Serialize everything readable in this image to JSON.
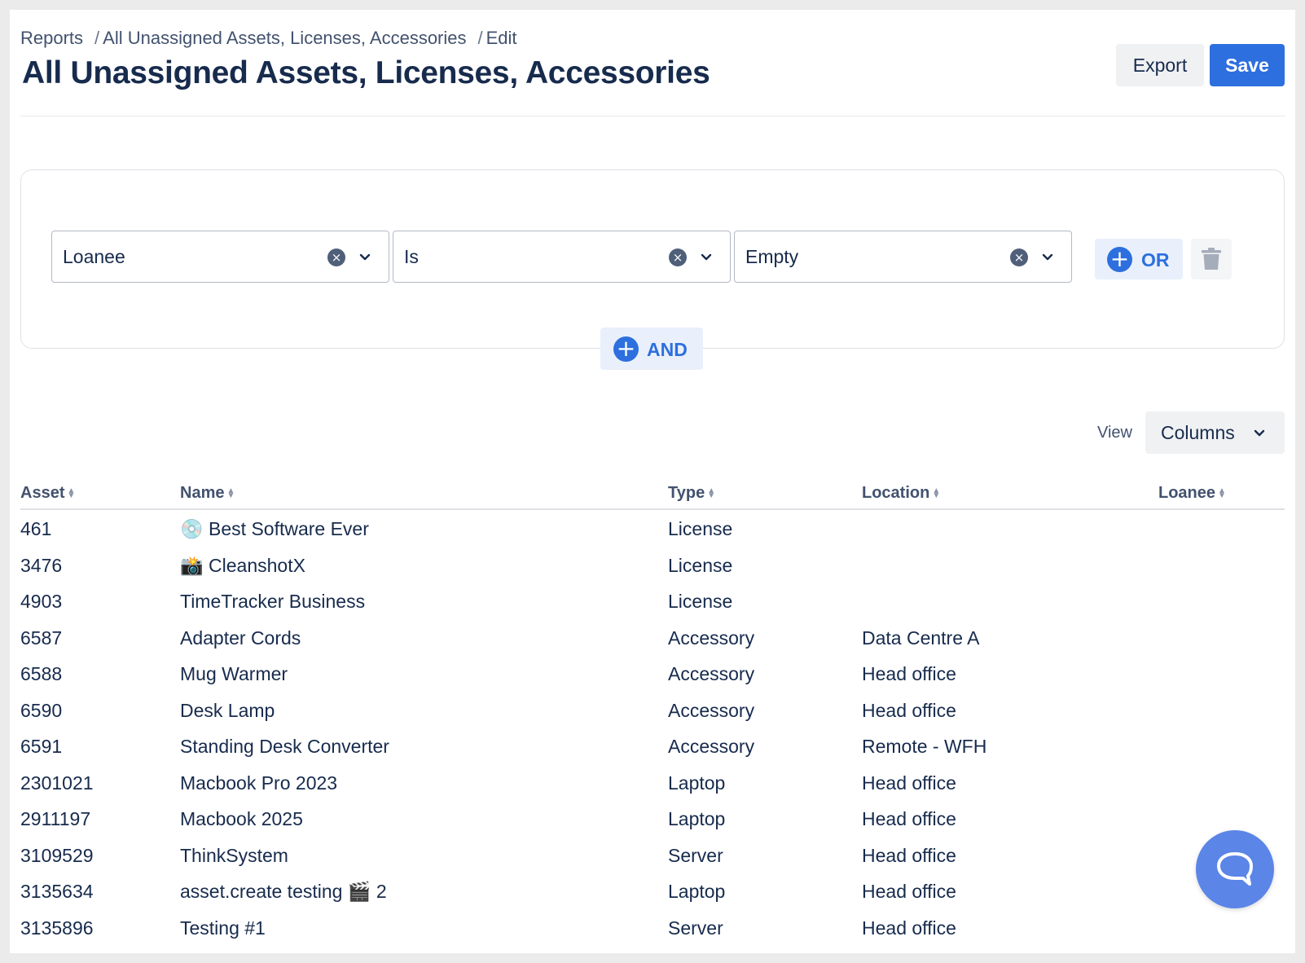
{
  "breadcrumb": {
    "items": [
      "Reports",
      "All Unassigned Assets, Licenses, Accessories",
      "Edit"
    ],
    "separator": "/"
  },
  "page": {
    "title": "All Unassigned Assets, Licenses, Accessories"
  },
  "header_actions": {
    "export_label": "Export",
    "save_label": "Save"
  },
  "filter": {
    "field": "Loanee",
    "operator": "Is",
    "value": "Empty",
    "or_label": "OR",
    "and_label": "AND"
  },
  "view": {
    "label": "View",
    "columns_label": "Columns"
  },
  "table": {
    "columns": [
      "Asset",
      "Name",
      "Type",
      "Location",
      "Loanee"
    ],
    "rows": [
      {
        "asset": "461",
        "name": "💿 Best Software Ever",
        "type": "License",
        "location": "",
        "loanee": ""
      },
      {
        "asset": "3476",
        "name": "📸 CleanshotX",
        "type": "License",
        "location": "",
        "loanee": ""
      },
      {
        "asset": "4903",
        "name": "TimeTracker Business",
        "type": "License",
        "location": "",
        "loanee": ""
      },
      {
        "asset": "6587",
        "name": "Adapter Cords",
        "type": "Accessory",
        "location": "Data Centre A",
        "loanee": ""
      },
      {
        "asset": "6588",
        "name": "Mug Warmer",
        "type": "Accessory",
        "location": "Head office",
        "loanee": ""
      },
      {
        "asset": "6590",
        "name": "Desk Lamp",
        "type": "Accessory",
        "location": "Head office",
        "loanee": ""
      },
      {
        "asset": "6591",
        "name": "Standing Desk Converter",
        "type": "Accessory",
        "location": "Remote - WFH",
        "loanee": ""
      },
      {
        "asset": "2301021",
        "name": "Macbook Pro 2023",
        "type": "Laptop",
        "location": "Head office",
        "loanee": ""
      },
      {
        "asset": "2911197",
        "name": "Macbook 2025",
        "type": "Laptop",
        "location": "Head office",
        "loanee": ""
      },
      {
        "asset": "3109529",
        "name": "ThinkSystem",
        "type": "Server",
        "location": "Head office",
        "loanee": ""
      },
      {
        "asset": "3135634",
        "name": "asset.create testing 🎬 2",
        "type": "Laptop",
        "location": "Head office",
        "loanee": ""
      },
      {
        "asset": "3135896",
        "name": "Testing #1",
        "type": "Server",
        "location": "Head office",
        "loanee": ""
      }
    ]
  },
  "icons": {
    "clear": "clear-circle-icon",
    "dropdown": "chevron-down-icon",
    "add": "plus-circle-icon",
    "delete": "trash-icon",
    "sort": "sort-icon",
    "chat": "chat-bubble-icon"
  },
  "colors": {
    "primary": "#2d6fde",
    "primary_soft": "#e9f0fc",
    "text": "#172b4d",
    "muted": "#42526e",
    "chat": "#5b85e6"
  }
}
